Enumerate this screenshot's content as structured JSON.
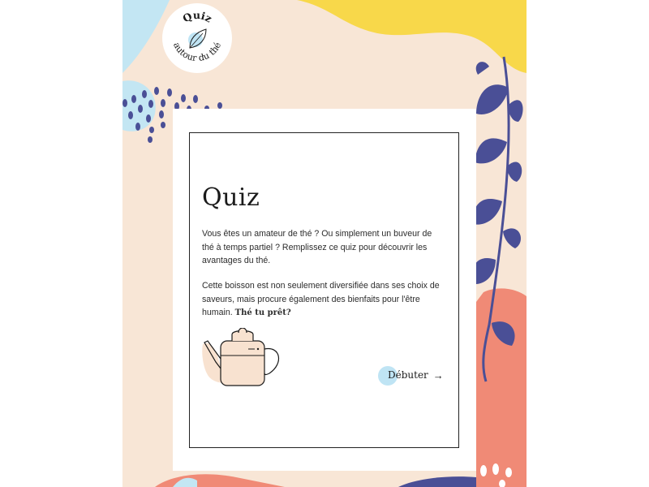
{
  "logo": {
    "line1": "Quiz",
    "line2": "autour du thé"
  },
  "card": {
    "title": "Quiz",
    "paragraph1": "Vous êtes un amateur de thé ? Ou simplement un buveur de thé à temps partiel ? Remplissez ce quiz pour découvrir les avantages du thé.",
    "paragraph2": "Cette boisson est non seulement diversifiée dans ses choix de saveurs, mais procure également des bienfaits pour l'être humain.",
    "paragraph2_bold": "Thé tu prêt?",
    "start_label": "Débuter"
  },
  "icons": {
    "logo": "leaf-icon",
    "start": "arrow-right-icon",
    "illustration": "teapot-icon"
  },
  "colors": {
    "cream": "#f8e6d6",
    "yellow": "#f8d84a",
    "light_blue": "#c3e6f3",
    "navy": "#4a4f96",
    "coral": "#f08a76",
    "pink": "#f6c9b9"
  }
}
